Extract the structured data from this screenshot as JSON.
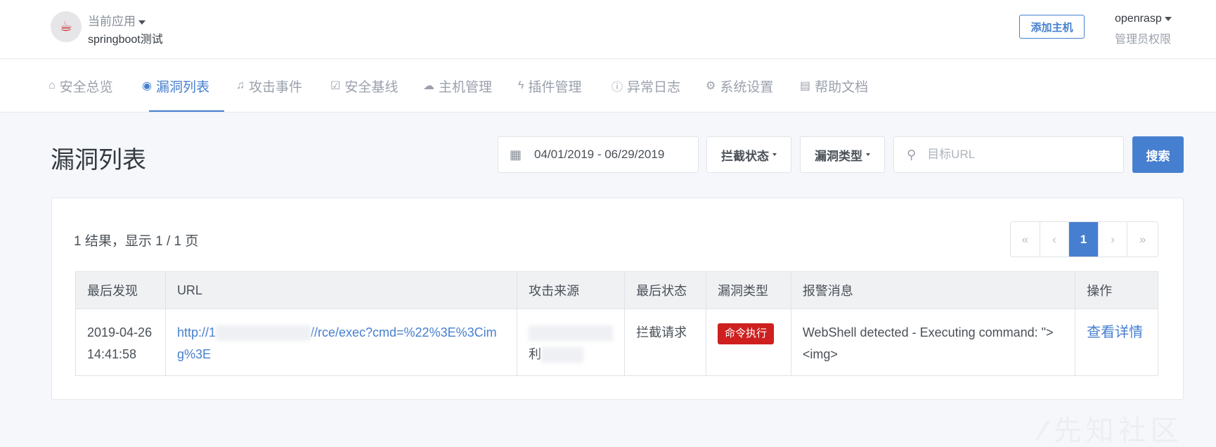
{
  "header": {
    "app_label": "当前应用",
    "app_name": "springboot测试",
    "add_host": "添加主机",
    "user_name": "openrasp",
    "user_role": "管理员权限"
  },
  "nav": {
    "items": [
      {
        "label": "安全总览",
        "icon": "home-icon"
      },
      {
        "label": "漏洞列表",
        "icon": "eye-icon",
        "active": true
      },
      {
        "label": "攻击事件",
        "icon": "bell-icon"
      },
      {
        "label": "安全基线",
        "icon": "checkbox-icon"
      },
      {
        "label": "主机管理",
        "icon": "cloud-icon"
      },
      {
        "label": "插件管理",
        "icon": "bolt-icon"
      },
      {
        "label": "异常日志",
        "icon": "alert-circle-icon"
      },
      {
        "label": "系统设置",
        "icon": "gear-icon"
      },
      {
        "label": "帮助文档",
        "icon": "file-icon"
      }
    ]
  },
  "page": {
    "title": "漏洞列表",
    "date_range": "04/01/2019 - 06/29/2019",
    "filter_block_status": "拦截状态",
    "filter_vuln_type": "漏洞类型",
    "search_placeholder": "目标URL",
    "search_button": "搜索"
  },
  "results": {
    "summary": "1 结果，显示 1 / 1 页",
    "pagination": {
      "first": "«",
      "prev": "‹",
      "current": "1",
      "next": "›",
      "last": "»"
    }
  },
  "table": {
    "columns": [
      "最后发现",
      "URL",
      "攻击来源",
      "最后状态",
      "漏洞类型",
      "报警消息",
      "操作"
    ],
    "rows": [
      {
        "date": "2019-04-26",
        "time": "14:41:58",
        "url_prefix": "http://1",
        "url_suffix": "//rce/exec?cmd=%22%3E%3Cimg%3E",
        "source_prefix": "利",
        "status": "拦截请求",
        "vuln_type": "命令执行",
        "message": "WebShell detected - Executing command: \"><img>",
        "action": "查看详情"
      }
    ]
  },
  "watermark": "先知社区",
  "colors": {
    "accent": "#467fcf",
    "danger": "#cd201f"
  }
}
